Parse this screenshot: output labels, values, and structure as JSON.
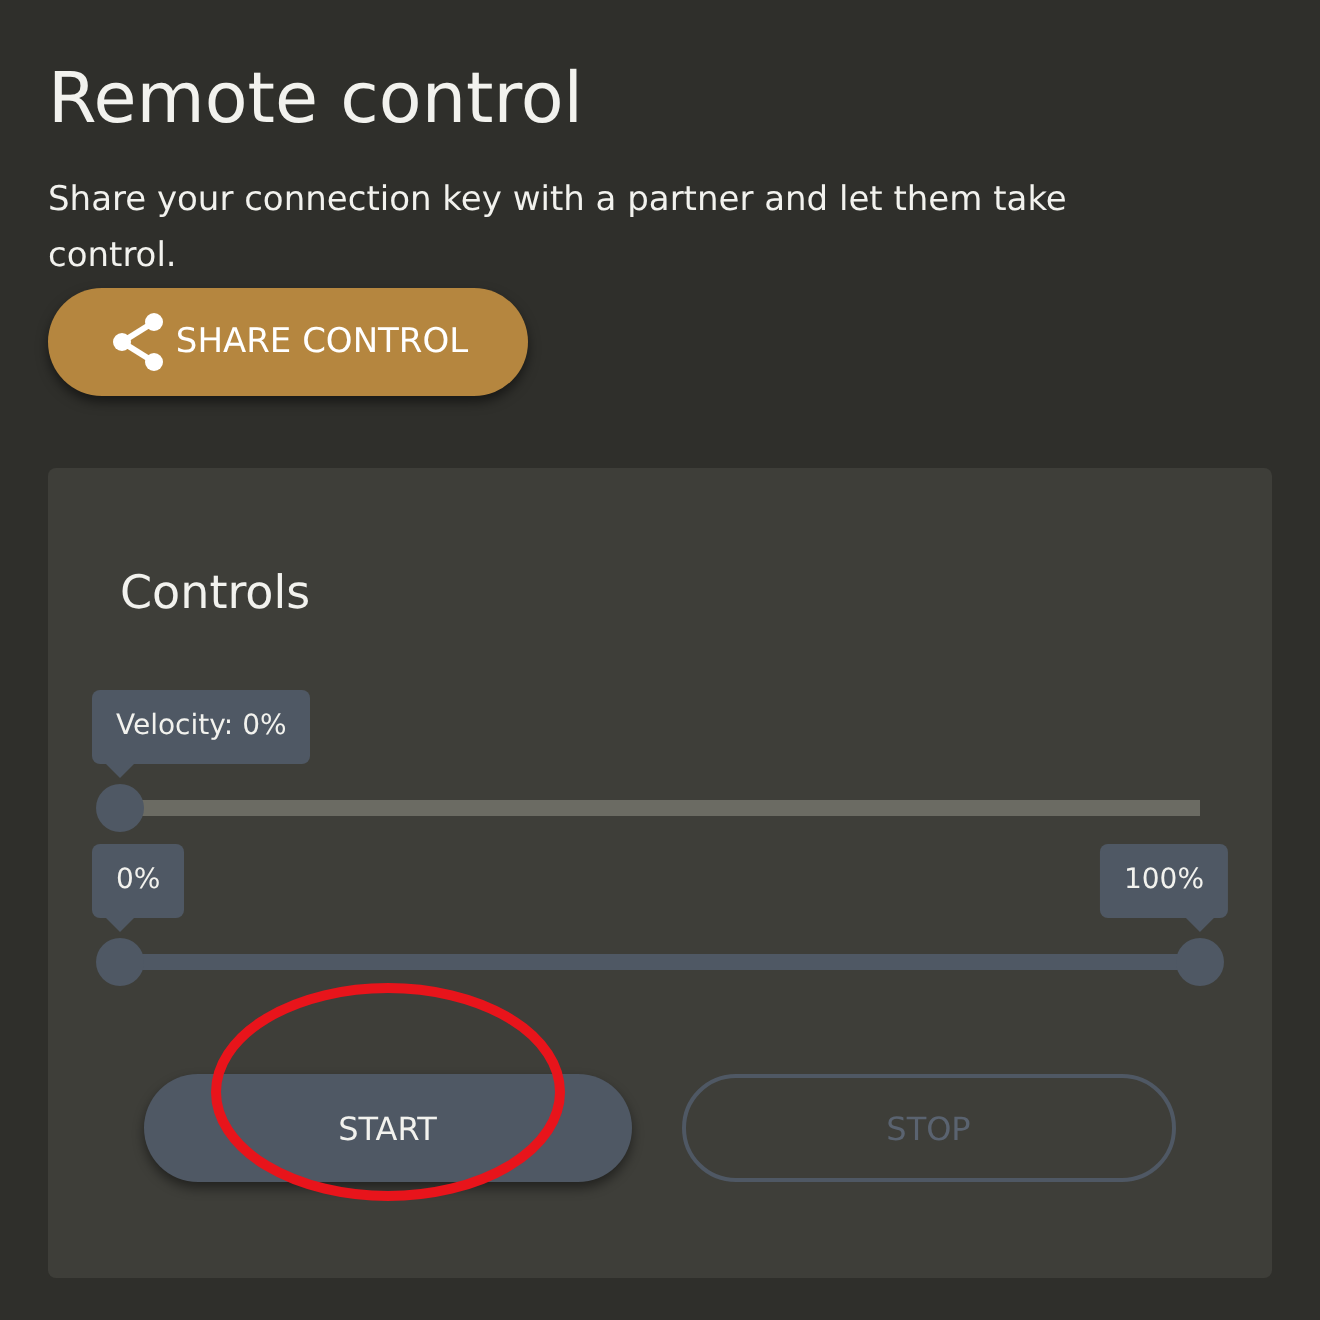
{
  "title": "Remote control",
  "description": "Share your connection key with a partner and let them take control.",
  "share_button": {
    "label": "SHARE CONTROL"
  },
  "controls": {
    "title": "Controls",
    "velocity": {
      "tooltip": "Velocity: 0%",
      "level": 0
    },
    "range": {
      "thumbs": [
        {
          "tooltip": "0%",
          "level": 0
        },
        {
          "tooltip": "100%",
          "level": 1
        }
      ]
    },
    "buttons": [
      {
        "label": "START",
        "disabled": false
      },
      {
        "label": "STOP",
        "disabled": true
      }
    ]
  },
  "annotations": [
    {
      "kind": "ellipse",
      "color": "#e8141b"
    }
  ]
}
